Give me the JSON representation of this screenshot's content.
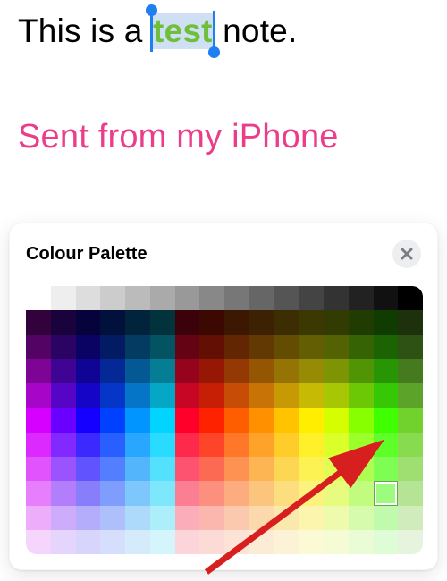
{
  "note": {
    "prefix": "This is a ",
    "selected_word": "test",
    "suffix": " note.",
    "signature": "Sent from my iPhone",
    "selected_color": "#6fbf3a"
  },
  "panel": {
    "title": "Colour Palette",
    "close_label": "Close"
  },
  "palette": {
    "cols": 16,
    "rows": 11,
    "selected": {
      "row": 8,
      "col": 14
    },
    "hues": [
      0,
      20,
      36,
      48,
      58,
      72,
      96,
      140,
      170,
      188,
      204,
      222,
      250,
      275,
      300,
      330
    ],
    "row_styles": [
      {
        "type": "gray_fade"
      },
      {
        "s": 95,
        "l": 12
      },
      {
        "s": 95,
        "l": 20
      },
      {
        "s": 95,
        "l": 30
      },
      {
        "s": 95,
        "l": 40
      },
      {
        "s": 100,
        "l": 50
      },
      {
        "s": 100,
        "l": 58
      },
      {
        "s": 98,
        "l": 66
      },
      {
        "s": 95,
        "l": 74
      },
      {
        "s": 90,
        "l": 83
      },
      {
        "s": 85,
        "l": 91
      }
    ]
  },
  "chart_data": {
    "type": "heatmap",
    "title": "Colour Palette",
    "rows": 11,
    "cols": 16,
    "row_meaning": "lightness (top=grayscale row, then dark→light)",
    "col_meaning": "hue sweep red→yellow→green→cyan→blue→magenta",
    "selected_cell": {
      "row": 8,
      "col": 14,
      "approx_color": "#7ed04a"
    }
  }
}
